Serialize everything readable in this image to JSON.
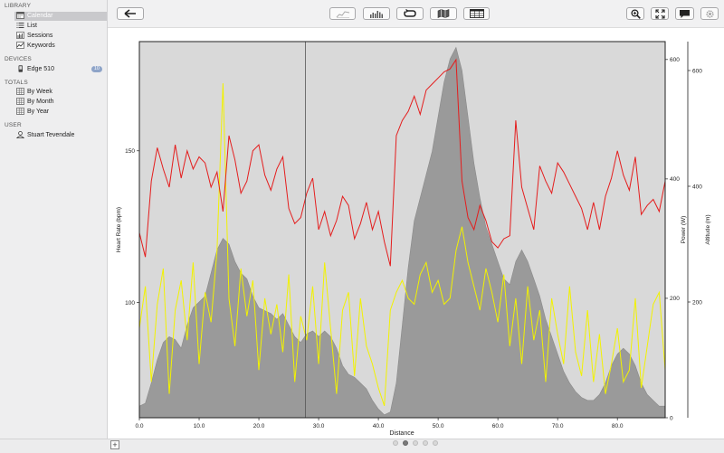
{
  "sidebar": {
    "library": {
      "title": "LIBRARY",
      "items": [
        {
          "label": "Calendar",
          "icon": "calendar-icon",
          "selected": true
        },
        {
          "label": "List",
          "icon": "list-icon"
        },
        {
          "label": "Sessions",
          "icon": "sessions-icon"
        },
        {
          "label": "Keywords",
          "icon": "keywords-icon"
        }
      ]
    },
    "devices": {
      "title": "DEVICES",
      "items": [
        {
          "label": "Edge 510",
          "icon": "device-icon",
          "badge": "10"
        }
      ]
    },
    "totals": {
      "title": "TOTALS",
      "items": [
        {
          "label": "By Week",
          "icon": "totals-icon"
        },
        {
          "label": "By Month",
          "icon": "totals-icon"
        },
        {
          "label": "By Year",
          "icon": "totals-icon"
        }
      ]
    },
    "user": {
      "title": "USER",
      "items": [
        {
          "label": "Stuart Tevendale",
          "icon": "user-icon"
        }
      ]
    }
  },
  "toolbar": {
    "back": "back-arrow-icon",
    "view_buttons": [
      "line-chart-icon",
      "bar-chart-icon",
      "loop-icon",
      "map-icon",
      "table-icon"
    ],
    "right_buttons": [
      "zoom-icon",
      "fullscreen-icon",
      "comment-icon",
      "settings-gear-icon"
    ]
  },
  "chart_data": {
    "type": "line",
    "xlabel": "Distance",
    "x_ticks": [
      "0.0",
      "10.0",
      "20.0",
      "30.0",
      "40.0",
      "50.0",
      "60.0",
      "70.0",
      "80.0"
    ],
    "xlim": [
      0,
      88
    ],
    "grid": false,
    "axes": [
      {
        "label": "Heart Rate (bpm)",
        "side": "left",
        "ticks": [
          "100",
          "150"
        ],
        "ylim": [
          62,
          186
        ]
      },
      {
        "label": "Power (W)",
        "side": "right",
        "ticks": [
          "0",
          "200",
          "400",
          "600"
        ],
        "ylim": [
          0,
          630
        ]
      },
      {
        "label": "Altitude (m)",
        "side": "right-outer",
        "ticks": [
          "200",
          "400",
          "600"
        ],
        "ylim": [
          0,
          650
        ]
      }
    ],
    "cursor_x": 27.8,
    "series": [
      {
        "name": "Heart Rate (bpm)",
        "color": "#e41d1d",
        "axis": 0,
        "x": [
          0,
          1,
          2,
          3,
          4,
          5,
          6,
          7,
          8,
          9,
          10,
          11,
          12,
          13,
          14,
          15,
          16,
          17,
          18,
          19,
          20,
          21,
          22,
          23,
          24,
          25,
          26,
          27,
          28,
          29,
          30,
          31,
          32,
          33,
          34,
          35,
          36,
          37,
          38,
          39,
          40,
          41,
          42,
          43,
          44,
          45,
          46,
          47,
          48,
          49,
          50,
          51,
          52,
          53,
          54,
          55,
          56,
          57,
          58,
          59,
          60,
          61,
          62,
          63,
          64,
          65,
          66,
          67,
          68,
          69,
          70,
          71,
          72,
          73,
          74,
          75,
          76,
          77,
          78,
          79,
          80,
          81,
          82,
          83,
          84,
          85,
          86,
          87,
          88
        ],
        "values": [
          123,
          115,
          140,
          151,
          144,
          138,
          152,
          141,
          150,
          144,
          148,
          146,
          138,
          143,
          130,
          155,
          147,
          136,
          140,
          150,
          152,
          142,
          137,
          144,
          148,
          131,
          126,
          128,
          136,
          141,
          124,
          130,
          122,
          127,
          135,
          132,
          121,
          126,
          133,
          124,
          130,
          120,
          112,
          155,
          160,
          163,
          168,
          162,
          170,
          172,
          174,
          176,
          177,
          180,
          140,
          128,
          124,
          132,
          127,
          120,
          118,
          121,
          122,
          160,
          138,
          131,
          124,
          145,
          140,
          136,
          146,
          143,
          139,
          135,
          131,
          124,
          133,
          124,
          135,
          141,
          150,
          142,
          137,
          148,
          129,
          132,
          134,
          130,
          140
        ]
      },
      {
        "name": "Altitude (m)",
        "color": "#9a9a9a",
        "axis": 2,
        "x": [
          0,
          1,
          2,
          3,
          4,
          5,
          6,
          7,
          8,
          9,
          10,
          11,
          12,
          13,
          14,
          15,
          16,
          17,
          18,
          19,
          20,
          21,
          22,
          23,
          24,
          25,
          26,
          27,
          28,
          29,
          30,
          31,
          32,
          33,
          34,
          35,
          36,
          37,
          38,
          39,
          40,
          41,
          42,
          43,
          44,
          45,
          46,
          47,
          48,
          49,
          50,
          51,
          52,
          53,
          54,
          55,
          56,
          57,
          58,
          59,
          60,
          61,
          62,
          63,
          64,
          65,
          66,
          67,
          68,
          69,
          70,
          71,
          72,
          73,
          74,
          75,
          76,
          77,
          78,
          79,
          80,
          81,
          82,
          83,
          84,
          85,
          86,
          87,
          88
        ],
        "values": [
          20,
          25,
          60,
          100,
          130,
          140,
          135,
          120,
          160,
          190,
          200,
          210,
          250,
          290,
          310,
          300,
          270,
          250,
          240,
          210,
          190,
          185,
          180,
          170,
          180,
          160,
          140,
          130,
          145,
          150,
          140,
          150,
          140,
          120,
          90,
          75,
          70,
          60,
          50,
          30,
          15,
          5,
          10,
          60,
          160,
          260,
          340,
          380,
          420,
          460,
          520,
          580,
          620,
          640,
          600,
          520,
          440,
          380,
          330,
          300,
          270,
          240,
          230,
          270,
          290,
          270,
          240,
          210,
          170,
          140,
          110,
          80,
          60,
          45,
          35,
          30,
          30,
          40,
          60,
          90,
          110,
          120,
          110,
          90,
          60,
          40,
          30,
          20,
          20
        ]
      },
      {
        "name": "Power (W)",
        "color": "#f2f200",
        "axis": 1,
        "x": [
          0,
          1,
          2,
          3,
          4,
          5,
          6,
          7,
          8,
          9,
          10,
          11,
          12,
          13,
          14,
          15,
          16,
          17,
          18,
          19,
          20,
          21,
          22,
          23,
          24,
          25,
          26,
          27,
          28,
          29,
          30,
          31,
          32,
          33,
          34,
          35,
          36,
          37,
          38,
          39,
          40,
          41,
          42,
          43,
          44,
          45,
          46,
          47,
          48,
          49,
          50,
          51,
          52,
          53,
          54,
          55,
          56,
          57,
          58,
          59,
          60,
          61,
          62,
          63,
          64,
          65,
          66,
          67,
          68,
          69,
          70,
          71,
          72,
          73,
          74,
          75,
          76,
          77,
          78,
          79,
          80,
          81,
          82,
          83,
          84,
          85,
          86,
          87,
          88
        ],
        "values": [
          150,
          220,
          60,
          190,
          250,
          40,
          180,
          230,
          130,
          260,
          90,
          210,
          160,
          280,
          560,
          200,
          120,
          250,
          170,
          230,
          80,
          200,
          140,
          190,
          110,
          240,
          60,
          170,
          130,
          220,
          90,
          260,
          150,
          40,
          180,
          210,
          70,
          200,
          120,
          90,
          50,
          20,
          180,
          210,
          230,
          200,
          190,
          240,
          260,
          210,
          230,
          190,
          200,
          280,
          320,
          260,
          220,
          180,
          250,
          210,
          160,
          240,
          120,
          200,
          90,
          220,
          130,
          180,
          60,
          200,
          140,
          90,
          220,
          110,
          70,
          180,
          60,
          140,
          40,
          90,
          150,
          60,
          80,
          200,
          50,
          120,
          190,
          210,
          80
        ]
      }
    ]
  }
}
